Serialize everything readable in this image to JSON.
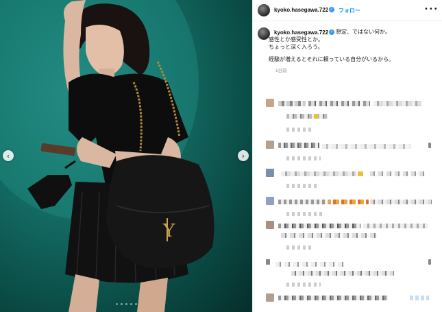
{
  "post": {
    "username": "kyoko.hasegawa.722",
    "follow_label": "フォロー",
    "more_label": "•••",
    "verified_glyph": "✓",
    "caption_lines": [
      "想定、ではない何か。",
      "感性とか感受性とか。",
      "ちょっと深く入ろう。",
      "",
      "経験が増えるとそれに頼っている自分がいるから。"
    ],
    "time_ago": "1日前"
  },
  "carousel": {
    "prev_icon": "‹",
    "next_icon": "›",
    "slide_count": 5,
    "active_slide": 1
  },
  "comments_blurred": true,
  "colors": {
    "accent": "#0095f6",
    "verified": "#3897f0",
    "photo_bg": "#147068"
  }
}
